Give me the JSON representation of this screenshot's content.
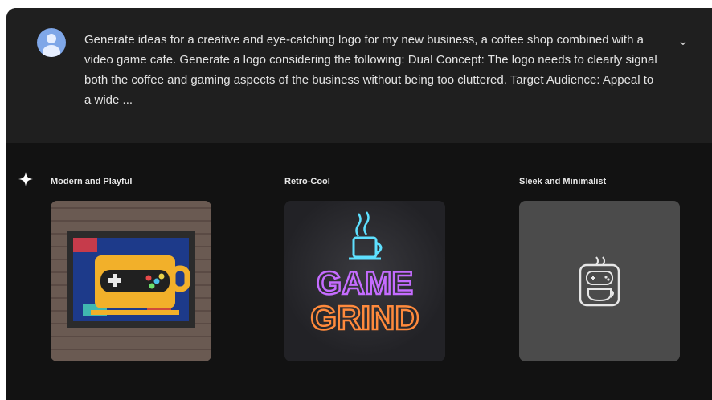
{
  "prompt": {
    "text": "Generate ideas for a creative and eye-catching logo for my new business, a coffee shop combined with a video game cafe. Generate a logo considering the following: Dual Concept: The logo needs to clearly signal both the coffee and gaming aspects of the business without being too cluttered. Target Audience: Appeal to a wide ...",
    "expand_icon": "chevron-down-icon"
  },
  "ideas": [
    {
      "label": "Modern and Playful"
    },
    {
      "label": "Retro-Cool"
    },
    {
      "label": "Sleek and Minimalist"
    }
  ],
  "thumb2": {
    "line1": "GAME",
    "line2": "GRIND"
  },
  "colors": {
    "background": "#121212",
    "card": "#1f1f1f",
    "avatar": "#7fa7e8"
  }
}
